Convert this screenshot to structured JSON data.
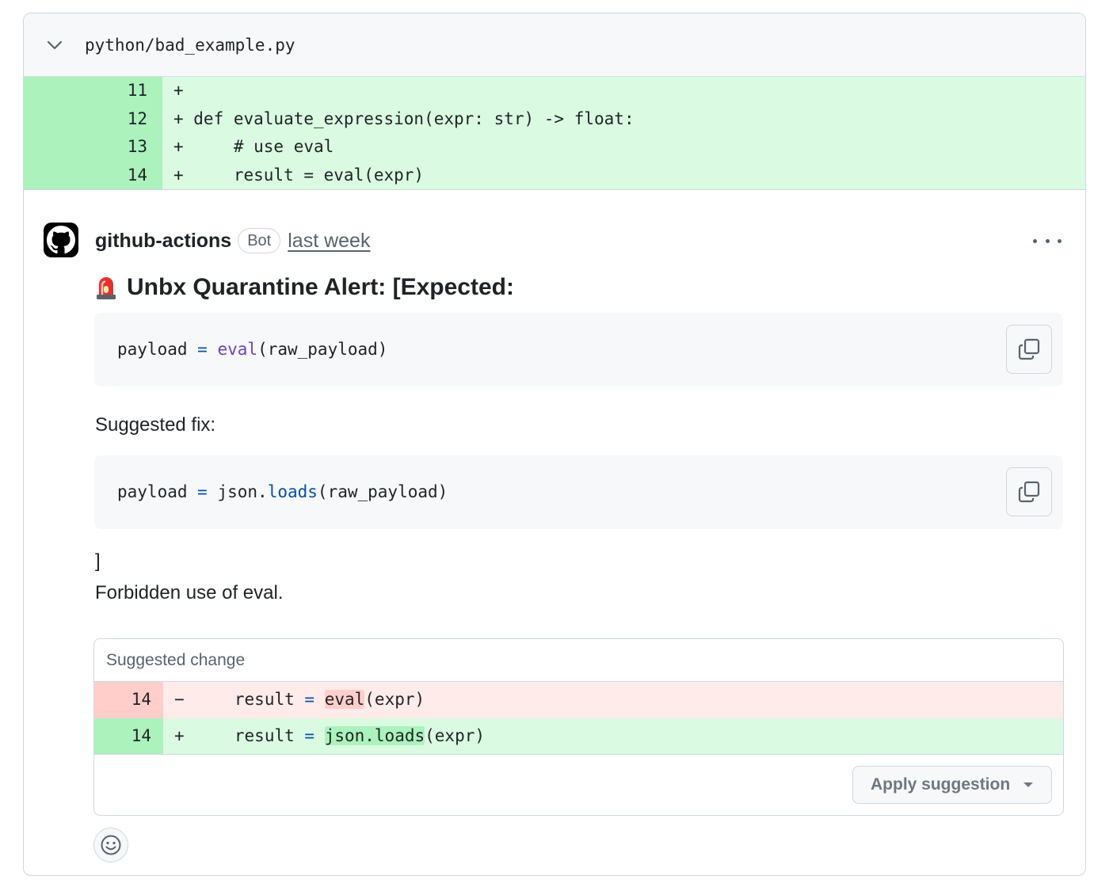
{
  "file": {
    "path": "python/bad_example.py",
    "lines": [
      {
        "number": "11",
        "code": "+"
      },
      {
        "number": "12",
        "code": "+ def evaluate_expression(expr: str) -> float:"
      },
      {
        "number": "13",
        "code": "+     # use eval"
      },
      {
        "number": "14",
        "code": "+     result = eval(expr)"
      }
    ]
  },
  "comment": {
    "author": "github-actions",
    "badge": "Bot",
    "timestamp": "last week",
    "title": "Unbx Quarantine Alert: [Expected:",
    "code_block_1": {
      "lhs": "payload",
      "op": "=",
      "fn": "eval",
      "args": "(raw_payload)"
    },
    "suggested_fix_label": "Suggested fix:",
    "code_block_2": {
      "lhs": "payload",
      "op": "=",
      "obj": "json.",
      "fn": "loads",
      "args": "(raw_payload)"
    },
    "closing_bracket": "]",
    "message": "Forbidden use of eval."
  },
  "suggestion": {
    "header": "Suggested change",
    "deleted": {
      "number": "14",
      "sign": "−",
      "pre": "    result ",
      "op": "=",
      "mid": " ",
      "hl": "eval",
      "post": "(expr)"
    },
    "added": {
      "number": "14",
      "sign": "+",
      "pre": "    result ",
      "op": "=",
      "mid": " ",
      "hl": "json.loads",
      "post": "(expr)"
    },
    "apply_label": "Apply suggestion"
  },
  "colors": {
    "added_bg": "#dafbe1",
    "added_gutter": "#abf2bc",
    "deleted_bg": "#ffebe9",
    "deleted_gutter": "#ffcecb"
  },
  "icons": [
    "chevron-down-icon",
    "github-octocat-icon",
    "kebab-horizontal-icon",
    "siren-icon",
    "copy-icon",
    "triangle-down-icon",
    "smiley-icon"
  ]
}
